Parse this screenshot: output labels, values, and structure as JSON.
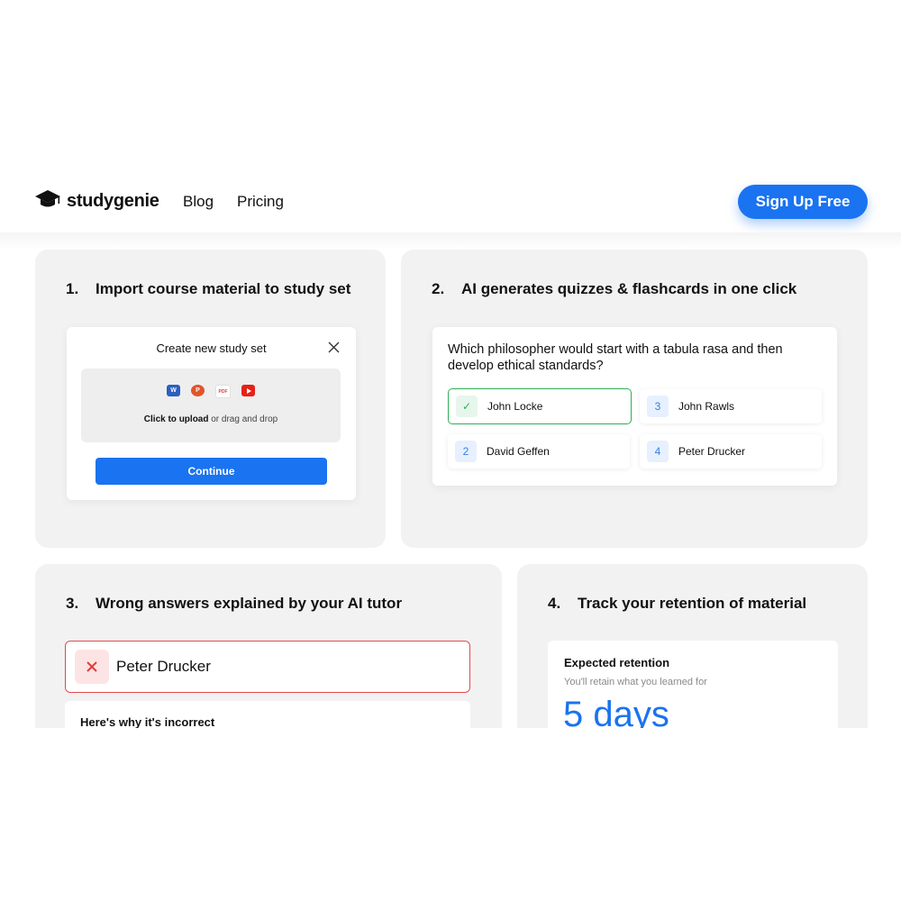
{
  "header": {
    "brand": "studygenie",
    "nav": [
      {
        "label": "Blog"
      },
      {
        "label": "Pricing"
      }
    ],
    "cta_label": "Sign Up Free"
  },
  "steps": [
    {
      "num": "1.",
      "title": "Import course material to study set",
      "dialog": {
        "title": "Create new study set",
        "file_types": [
          "word-icon",
          "powerpoint-icon",
          "pdf-icon",
          "youtube-icon"
        ],
        "upload_strong": "Click to upload",
        "upload_rest": " or drag and drop",
        "continue_label": "Continue"
      }
    },
    {
      "num": "2.",
      "title": "AI generates quizzes & flashcards in one click",
      "question": "Which philosopher would start with a tabula rasa and then develop ethical standards?",
      "options": [
        {
          "badge": "✓",
          "label": "John Locke",
          "correct": true
        },
        {
          "badge": "3",
          "label": "John Rawls"
        },
        {
          "badge": "2",
          "label": "David Geffen"
        },
        {
          "badge": "4",
          "label": "Peter Drucker"
        }
      ]
    },
    {
      "num": "3.",
      "title": "Wrong answers explained by your AI tutor",
      "wrong_answer": "Peter Drucker",
      "explanation_heading": "Here's why it's incorrect"
    },
    {
      "num": "4.",
      "title": "Track your retention of material",
      "retention_heading": "Expected retention",
      "retention_sub": "You'll retain what you learned for",
      "retention_value": "5 days"
    }
  ],
  "colors": {
    "accent": "#1a73f0",
    "correct": "#2fae55",
    "wrong": "#e64b4b",
    "card_bg": "#f2f2f2"
  }
}
